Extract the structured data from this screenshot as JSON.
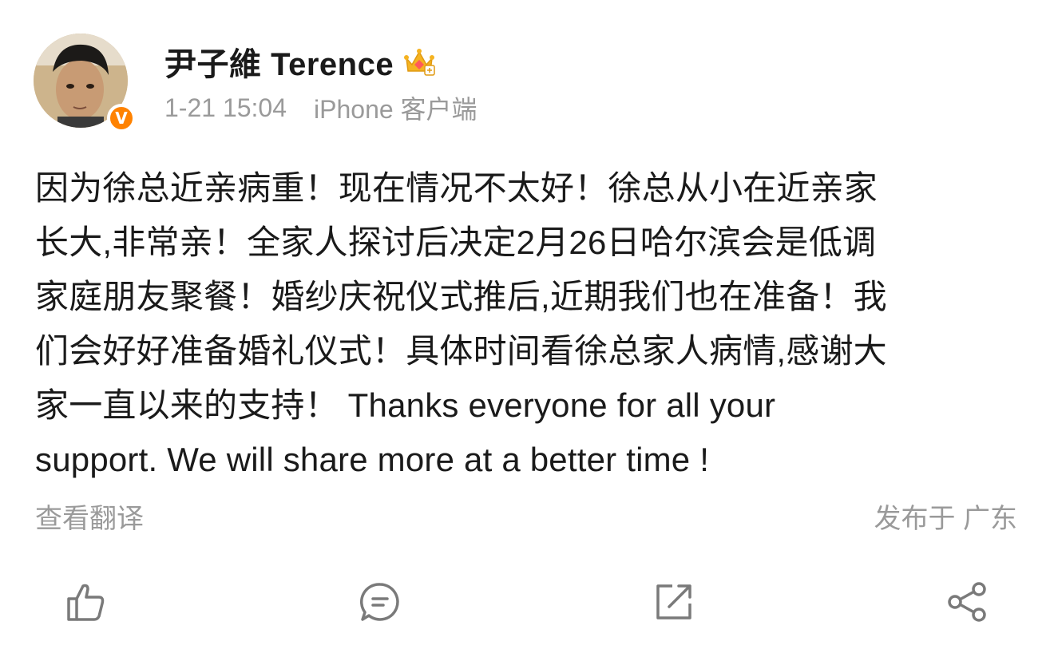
{
  "post": {
    "username": "尹子維 Terence",
    "timestamp": "1-21 15:04",
    "source": "iPhone 客户端",
    "text_lines": [
      "因为徐总近亲病重！现在情况不太好！徐总从小在近亲家",
      "长大,非常亲！全家人探讨后决定2月26日哈尔滨会是低调",
      "家庭朋友聚餐！婚纱庆祝仪式推后,近期我们也在准备！我",
      "们会好好准备婚礼仪式！具体时间看徐总家人病情,感谢大",
      "家一直以来的支持！ Thanks everyone for all your",
      "support.  We will share more at a better time !"
    ],
    "translate_label": "查看翻译",
    "location": "发布于 广东",
    "verified_badge": "V"
  },
  "icons": {
    "avatar": "avatar",
    "verified": "verified-badge-icon",
    "vip": "vip-crown-icon",
    "like": "thumbs-up-icon",
    "comment": "comment-bubble-icon",
    "repost": "repost-icon",
    "share": "share-icon"
  },
  "colors": {
    "text": "#1a1a1a",
    "muted": "#9a9a9a",
    "verified": "#ff8200",
    "icon": "#7a7a7a"
  }
}
